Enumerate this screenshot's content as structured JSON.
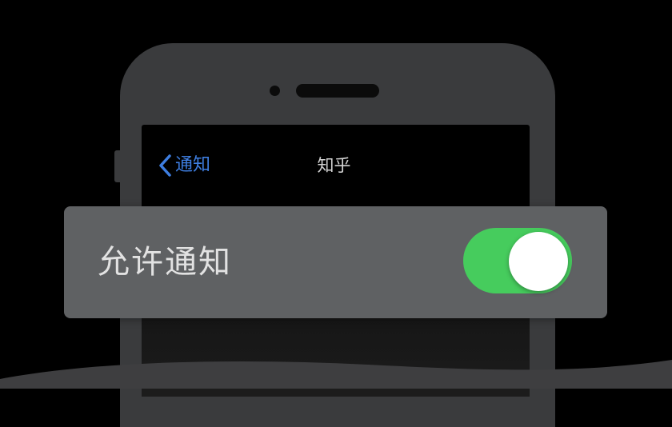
{
  "nav": {
    "back_label": "通知",
    "title": "知乎"
  },
  "setting": {
    "label": "允许通知",
    "enabled": true,
    "on_color": "#46cc5d"
  },
  "colors": {
    "background": "#000000",
    "phone_body": "#3a3b3d",
    "card": "#5f6163",
    "link": "#3e7ee0"
  },
  "icons": {
    "back": "chevron-left-icon"
  }
}
